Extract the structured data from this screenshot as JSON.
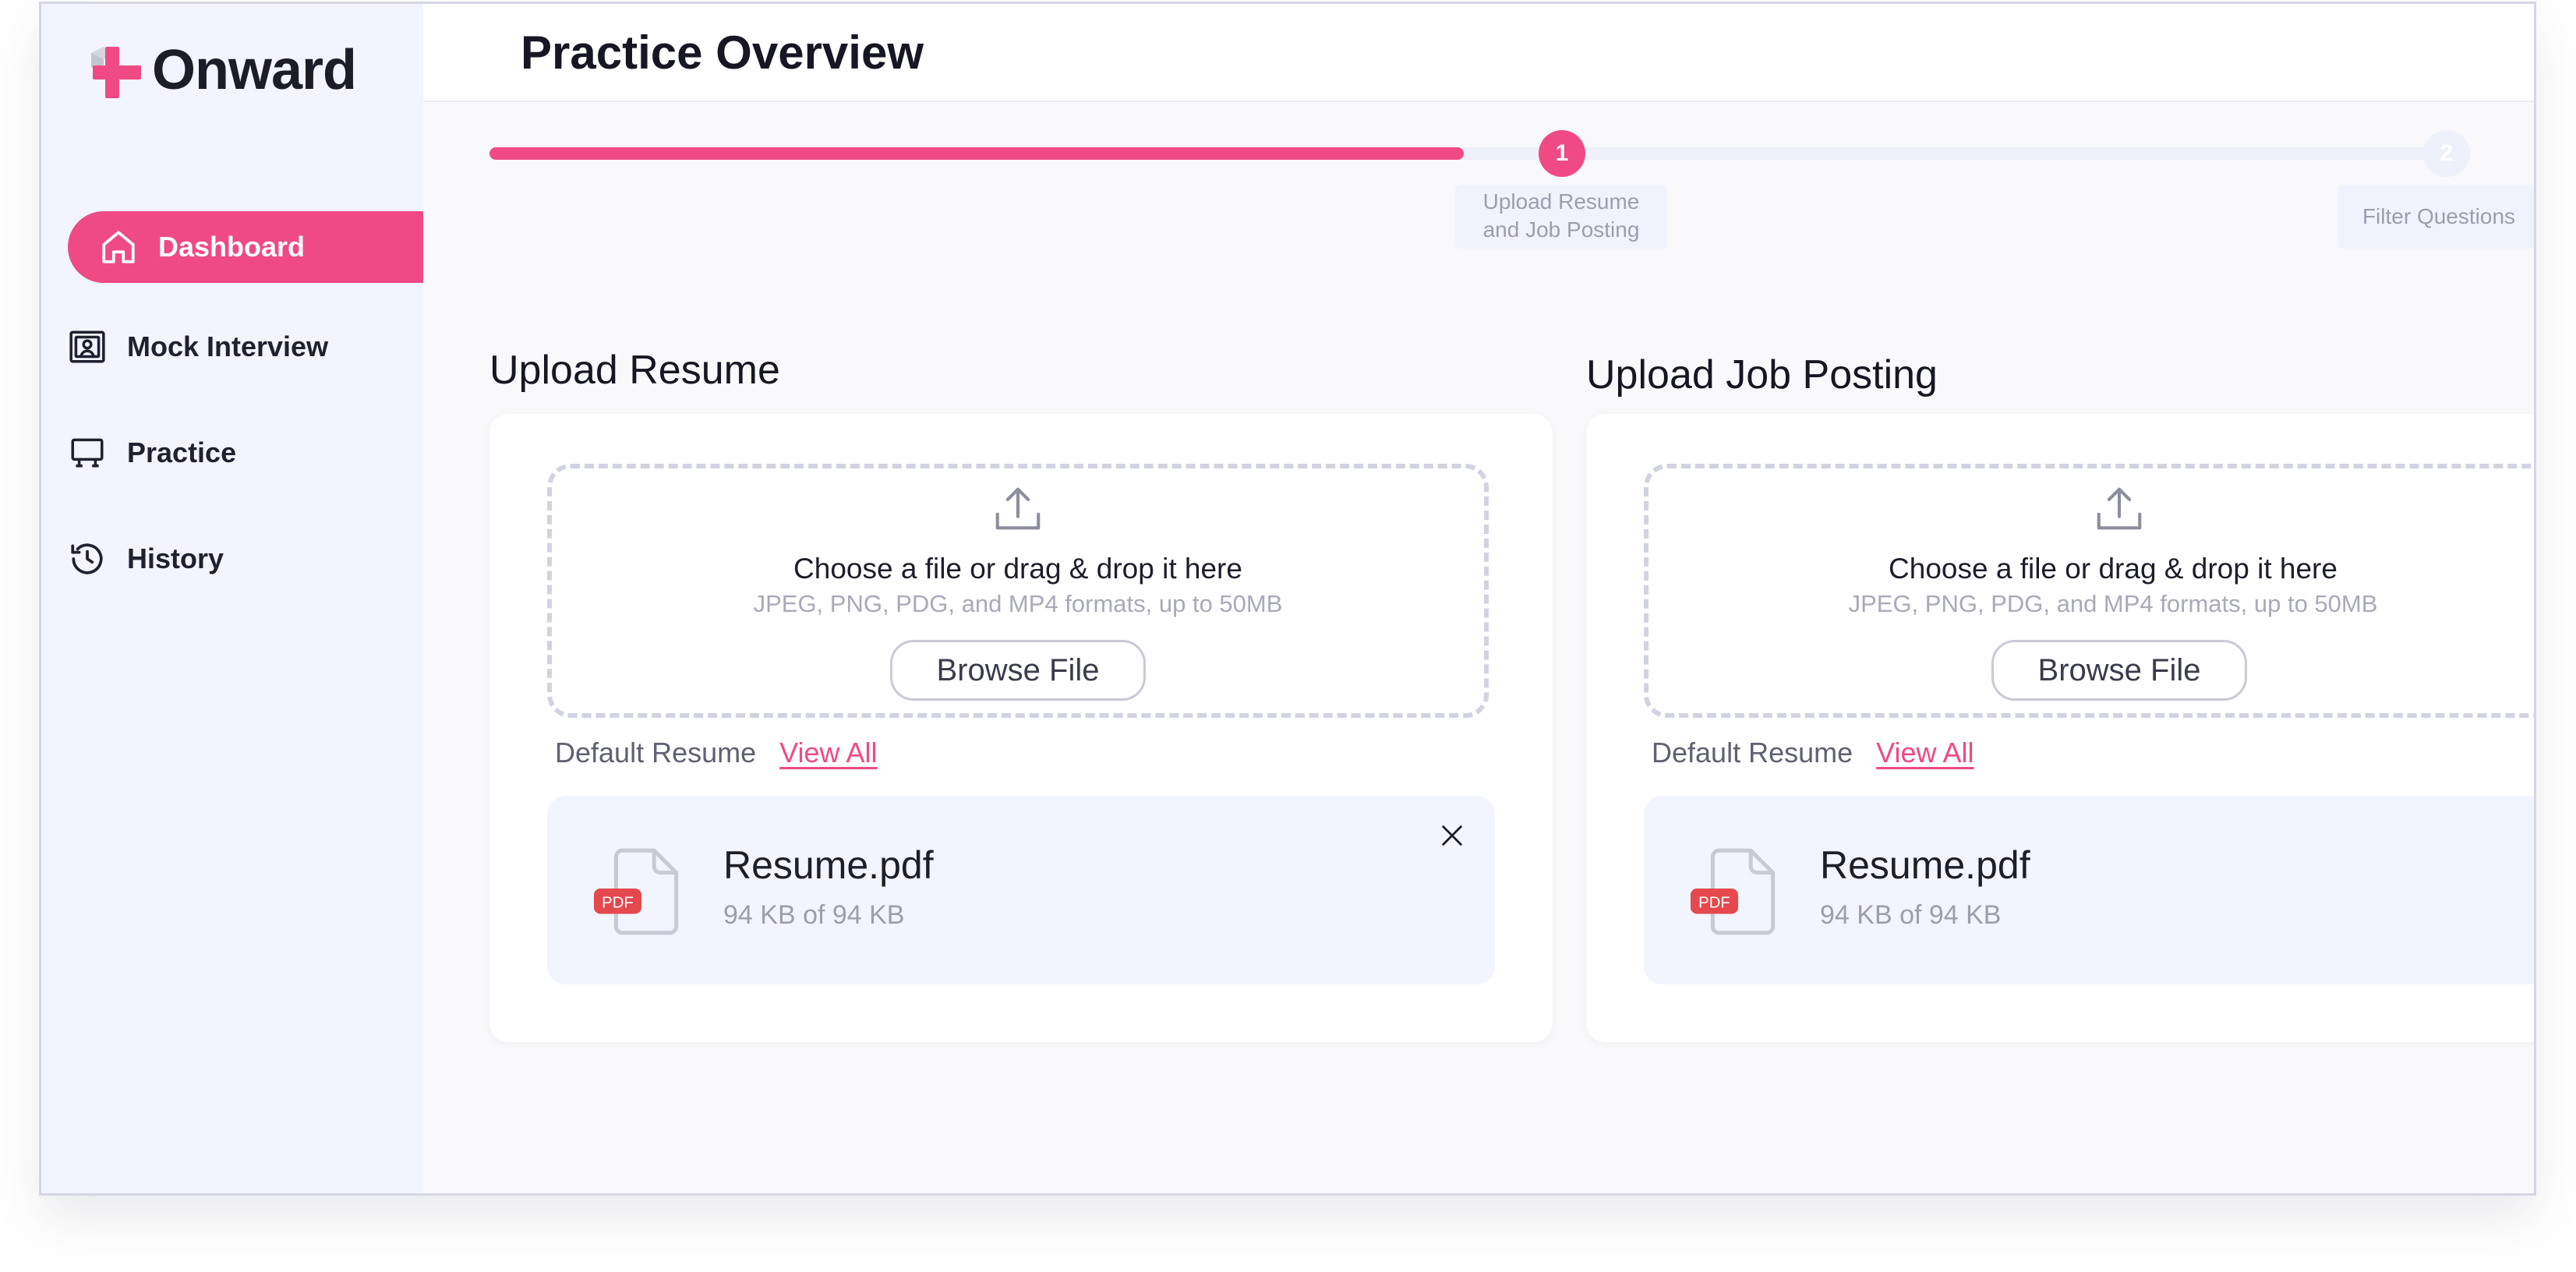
{
  "app": {
    "name": "Onward"
  },
  "sidebar": {
    "items": [
      {
        "label": "Dashboard",
        "icon": "home-icon",
        "active": true
      },
      {
        "label": "Mock Interview",
        "icon": "interview-icon",
        "active": false
      },
      {
        "label": "Practice",
        "icon": "presentation-board-icon",
        "active": false
      },
      {
        "label": "History",
        "icon": "history-icon",
        "active": false
      }
    ]
  },
  "header": {
    "title": "Practice Overview"
  },
  "stepper": {
    "progress": 0.5,
    "steps": [
      {
        "number": "1",
        "label": "Upload Resume and Job Posting",
        "status": "complete"
      },
      {
        "number": "2",
        "label": "Filter Questions",
        "status": "pending"
      }
    ]
  },
  "resume_section": {
    "title": "Upload Resume",
    "dropzone_title": "Choose a file or drag & drop it here",
    "dropzone_subtitle": "JPEG, PNG, PDG, and MP4 formats, up to 50MB",
    "browse_label": "Browse File",
    "default_label": "Default Resume",
    "view_all_label": "View All",
    "file": {
      "name": "Resume.pdf",
      "size": "94 KB of 94 KB",
      "badge": "PDF"
    }
  },
  "job_section": {
    "title": "Upload Job Posting",
    "dropzone_title": "Choose a file or drag & drop it here",
    "dropzone_subtitle": "JPEG, PNG, PDG, and MP4 formats, up to 50MB",
    "browse_label": "Browse File",
    "default_label": "Default Resume",
    "view_all_label": "View All",
    "file": {
      "name": "Resume.pdf",
      "size": "94 KB of 94 KB",
      "badge": "PDF"
    }
  },
  "colors": {
    "accent": "#ef4a84",
    "sidebar_bg": "#f2f4fe",
    "pdf_badge": "#e5484d"
  }
}
